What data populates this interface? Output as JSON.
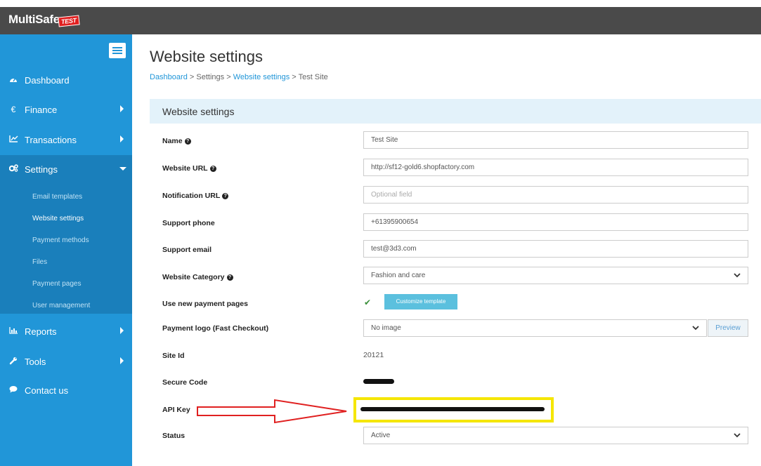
{
  "app": {
    "logo_text": "MultiSafe",
    "logo_badge": "TEST"
  },
  "sidebar": {
    "menu_icon": "hamburger-icon",
    "items": [
      {
        "label": "Dashboard",
        "icon": "dashboard-icon"
      },
      {
        "label": "Finance",
        "icon": "euro-icon"
      },
      {
        "label": "Transactions",
        "icon": "line-chart-icon"
      },
      {
        "label": "Settings",
        "icon": "cogs-icon"
      },
      {
        "label": "Reports",
        "icon": "bar-chart-icon"
      },
      {
        "label": "Tools",
        "icon": "wrench-icon"
      },
      {
        "label": "Contact us",
        "icon": "chat-icon"
      }
    ],
    "settings_submenu": [
      "Email templates",
      "Website settings",
      "Payment methods",
      "Files",
      "Payment pages",
      "User management"
    ],
    "active_sub": "Website settings"
  },
  "page": {
    "title": "Website settings",
    "breadcrumb": [
      "Dashboard",
      "Settings",
      "Website settings",
      "Test Site"
    ],
    "breadcrumb_sep": ">"
  },
  "panel": {
    "title": "Website settings",
    "fields": {
      "name_label": "Name",
      "name_value": "Test Site",
      "url_label": "Website URL",
      "url_value": "http://sf12-gold6.shopfactory.com",
      "notification_label": "Notification URL",
      "notification_placeholder": "Optional field",
      "phone_label": "Support phone",
      "phone_value": "+61395900654",
      "email_label": "Support email",
      "email_value": "test@3d3.com",
      "category_label": "Website Category",
      "category_value": "Fashion and care",
      "new_pages_label": "Use new payment pages",
      "customize_button": "Customize template",
      "logo_label": "Payment logo (Fast Checkout)",
      "logo_value": "No image",
      "preview_button": "Preview",
      "siteid_label": "Site Id",
      "siteid_value": "20121",
      "secure_label": "Secure Code",
      "apikey_label": "API Key",
      "status_label": "Status",
      "status_value": "Active"
    }
  },
  "colors": {
    "sidebar": "#2196d8",
    "sidebar_active": "#1a7fbb",
    "topbar": "#4a4a4a",
    "annotation_arrow": "#e02020",
    "annotation_box": "#f5e600"
  }
}
